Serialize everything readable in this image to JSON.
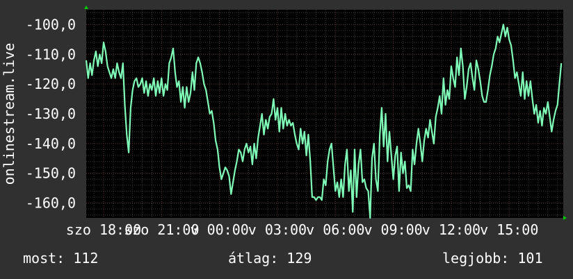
{
  "chart_data": {
    "type": "line",
    "ylabel": "onlinestream.live",
    "ylim": [
      -165,
      -95
    ],
    "y_ticks": [
      -100,
      -110,
      -120,
      -130,
      -140,
      -150,
      -160
    ],
    "y_tick_labels": [
      "-100,0",
      "-110,0",
      "-120,0",
      "-130,0",
      "-140,0",
      "-150,0",
      "-160,0"
    ],
    "x_tick_labels": [
      "szo 18:00",
      "szo 21:00",
      "v 00:00",
      "v 03:00",
      "v 06:00",
      "v 09:00",
      "v 12:00",
      "v 15:00"
    ],
    "x_hours": [
      0,
      3,
      6,
      9,
      12,
      15,
      18,
      21
    ],
    "x_range_hours": [
      -0.9,
      23.8
    ],
    "grid": true,
    "colors": {
      "line": "#80ffb8",
      "background": "#000000",
      "grid_major": "#5a3030",
      "grid_minor": "#3a3a3a",
      "frame": "#303030",
      "arrow": "#00cc00"
    },
    "series": [
      {
        "sample_hours": 0.1,
        "values": [
          -112,
          -118,
          -113,
          -117,
          -112,
          -109,
          -114,
          -110,
          -113,
          -106,
          -109,
          -114,
          -116,
          -118,
          -115,
          -118,
          -113,
          -116,
          -118,
          -113,
          -127,
          -137,
          -143,
          -128,
          -122,
          -119,
          -118,
          -121,
          -120,
          -118,
          -123,
          -119,
          -124,
          -120,
          -122,
          -118,
          -124,
          -119,
          -123,
          -118,
          -124,
          -120,
          -122,
          -113,
          -111,
          -108,
          -116,
          -121,
          -119,
          -126,
          -121,
          -128,
          -121,
          -126,
          -123,
          -116,
          -122,
          -113,
          -111,
          -113,
          -116,
          -120,
          -122,
          -126,
          -130,
          -129,
          -133,
          -139,
          -142,
          -148,
          -152,
          -150,
          -148,
          -149,
          -151,
          -157,
          -153,
          -149,
          -146,
          -142,
          -143,
          -146,
          -142,
          -140,
          -143,
          -141,
          -147,
          -140,
          -145,
          -138,
          -134,
          -130,
          -137,
          -132,
          -135,
          -131,
          -130,
          -125,
          -132,
          -128,
          -136,
          -128,
          -135,
          -130,
          -134,
          -132,
          -134,
          -133,
          -137,
          -140,
          -142,
          -135,
          -140,
          -136,
          -144,
          -137,
          -146,
          -158,
          -158,
          -159,
          -158,
          -158,
          -159,
          -152,
          -154,
          -146,
          -142,
          -140,
          -148,
          -156,
          -153,
          -158,
          -152,
          -158,
          -147,
          -142,
          -156,
          -149,
          -163,
          -142,
          -158,
          -147,
          -142,
          -153,
          -152,
          -155,
          -156,
          -165,
          -145,
          -140,
          -152,
          -156,
          -137,
          -128,
          -141,
          -130,
          -146,
          -136,
          -144,
          -152,
          -144,
          -141,
          -156,
          -143,
          -150,
          -146,
          -155,
          -154,
          -156,
          -142,
          -147,
          -140,
          -135,
          -140,
          -146,
          -139,
          -135,
          -138,
          -132,
          -136,
          -140,
          -131,
          -128,
          -124,
          -130,
          -118,
          -127,
          -122,
          -125,
          -114,
          -118,
          -121,
          -111,
          -117,
          -108,
          -114,
          -125,
          -121,
          -115,
          -113,
          -118,
          -122,
          -112,
          -115,
          -119,
          -124,
          -126,
          -126,
          -122,
          -117,
          -114,
          -110,
          -108,
          -104,
          -106,
          -103,
          -100,
          -104,
          -101,
          -105,
          -107,
          -112,
          -118,
          -116,
          -120,
          -124,
          -116,
          -125,
          -119,
          -124,
          -119,
          -125,
          -130,
          -127,
          -133,
          -129,
          -134,
          -128,
          -130,
          -126,
          -131,
          -136,
          -132,
          -129,
          -127,
          -120,
          -113,
          -110,
          -105,
          -108,
          -113,
          -111,
          -116,
          -121,
          -124,
          -128,
          -130,
          -127,
          -118,
          -123,
          -115,
          -122,
          -119,
          -113,
          -112
        ]
      }
    ]
  },
  "stats": {
    "now": "most: 112",
    "avg": "átlag: 129",
    "best": "legjobb: 101"
  }
}
